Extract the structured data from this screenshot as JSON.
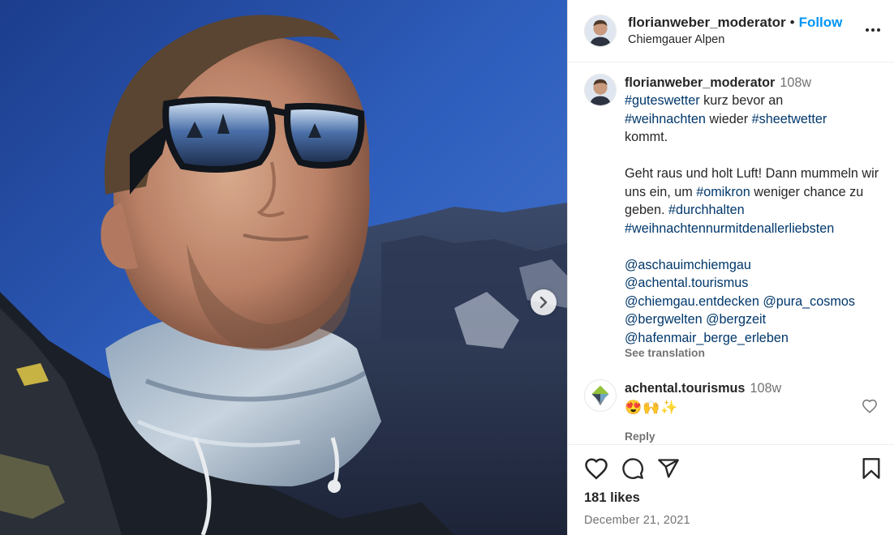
{
  "header": {
    "username": "florianweber_moderator",
    "separator": "•",
    "follow_label": "Follow",
    "location": "Chiemgauer Alpen",
    "more_icon": "more-options-icon"
  },
  "caption": {
    "username": "florianweber_moderator",
    "time": "108w",
    "line1_tag": "#guteswetter",
    "line1_text": " kurz bevor an ",
    "line2_tag": "#weihnachten",
    "line2_text": " wieder ",
    "line2_tag2": "#sheetwetter",
    "line3_text": " kommt.",
    "p2_text1": "Geht raus und holt Luft! Dann mummeln wir uns ein, um ",
    "p2_tag1": "#omikron",
    "p2_text2": " weniger chance zu geben. ",
    "p2_tag2": "#durchhalten",
    "p2_tag3": "#weihnachtennurmitdenallerliebsten",
    "mention1": "@aschauimchiemgau",
    "mention2": "@achental.tourismus",
    "mention3": "@chiemgau.entdecken",
    "mention4": "@pura_cosmos",
    "mention5": "@bergwelten",
    "mention6": "@bergzeit",
    "mention7": "@hafenmair_berge_erleben",
    "see_translation": "See translation"
  },
  "comment": {
    "username": "achental.tourismus",
    "time": "108w",
    "emojis": "😍🙌✨",
    "reply_label": "Reply"
  },
  "actions": {
    "likes": "181 likes",
    "date": "December 21, 2021"
  },
  "colors": {
    "accent": "#0095f6",
    "hashtag": "#00376b",
    "muted": "#737373"
  }
}
